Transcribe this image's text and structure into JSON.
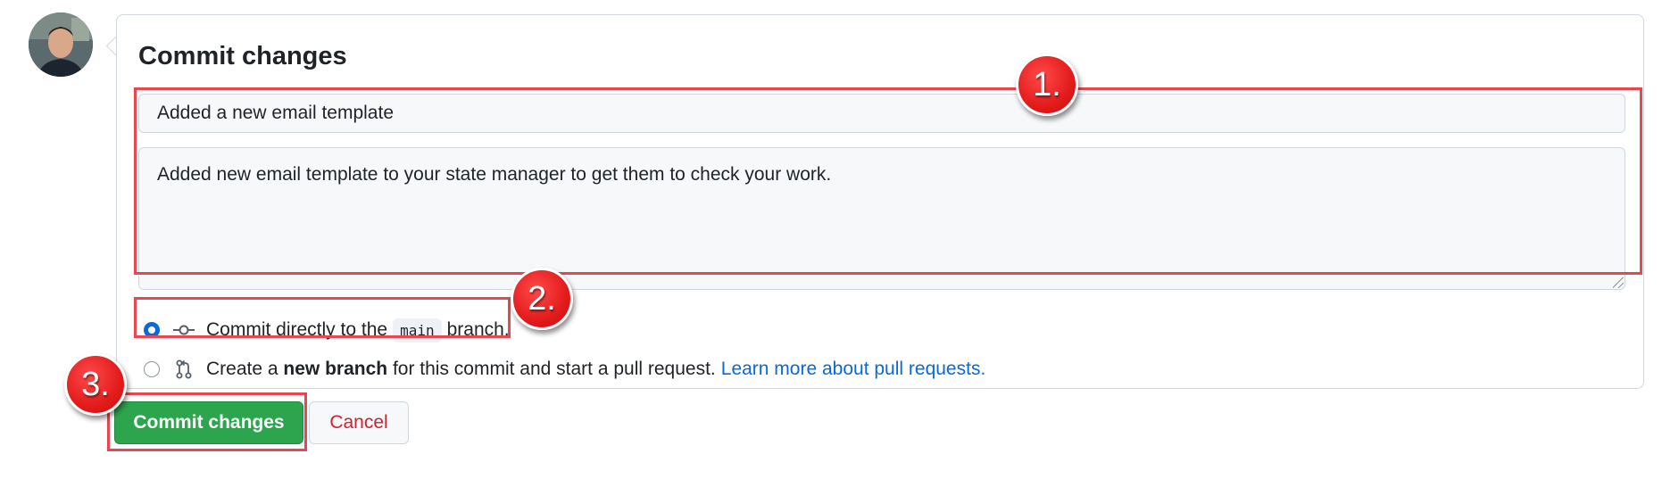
{
  "avatar": {
    "icon": "user-avatar-photo"
  },
  "commit": {
    "title": "Commit changes",
    "summary_value": "Added a new email template",
    "description_value": "Added new email template to your state manager to get them to check your work."
  },
  "options": {
    "direct": {
      "prefix": "Commit directly to the",
      "branch": "main",
      "suffix": "branch.",
      "icon": "git-commit-icon",
      "checked": true
    },
    "new_branch": {
      "prefix": "Create a",
      "bold": "new branch",
      "suffix": "for this commit and start a pull request.",
      "link": "Learn more about pull requests.",
      "icon": "git-pull-request-icon",
      "checked": false
    }
  },
  "buttons": {
    "commit_label": "Commit changes",
    "cancel_label": "Cancel"
  },
  "annotations": {
    "badge_1": "1.",
    "badge_2": "2.",
    "badge_3": "3.",
    "highlight_color": "#e8474f"
  },
  "colors": {
    "commit_button": "#2da44e",
    "cancel_text": "#cf222e",
    "link": "#0969da"
  }
}
